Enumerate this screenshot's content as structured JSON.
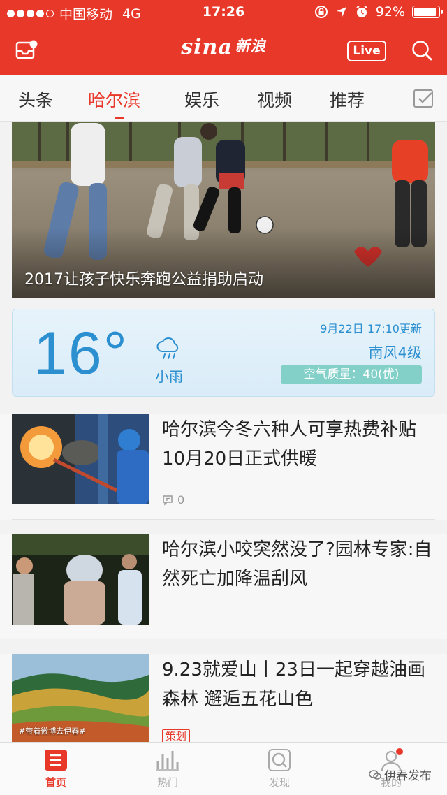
{
  "status": {
    "carrier": "中国移动",
    "network": "4G",
    "time": "17:26",
    "battery": "92%",
    "battery_level": 0.92
  },
  "header": {
    "logo": "sina",
    "logo_cn": "新浪",
    "live_label": "Live"
  },
  "tabs": [
    "头条",
    "哈尔滨",
    "娱乐",
    "视频",
    "推荐"
  ],
  "active_tab": "哈尔滨",
  "hero": {
    "caption": "2017让孩子快乐奔跑公益捐助启动"
  },
  "weather": {
    "temperature": "16°",
    "condition": "小雨",
    "updated": "9月22日 17:10更新",
    "wind": "南风4级",
    "air_quality": "空气质量：40(优)"
  },
  "news": [
    {
      "title": "哈尔滨今冬六种人可享热费补贴 10月20日正式供暖",
      "comments": "0"
    },
    {
      "title": "哈尔滨小咬突然没了?园林专家:自然死亡加降温刮风"
    },
    {
      "title": "9.23就爱山丨23日一起穿越油画森林 邂逅五花山色",
      "tag": "策划",
      "thumb_caption": "#带着微博去伊春#"
    }
  ],
  "bottom_nav": [
    "首页",
    "热门",
    "发现",
    "我的"
  ],
  "watermark": "伊春发布",
  "colors": {
    "brand": "#e8382a",
    "weather_blue": "#2b8fd0",
    "aqi_bg": "#83d0c9"
  }
}
